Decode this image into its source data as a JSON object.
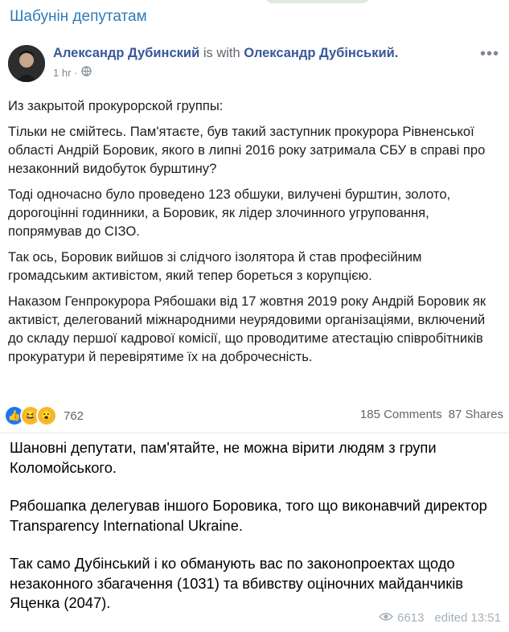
{
  "channel": {
    "title": "Шабунін депутатам"
  },
  "post": {
    "author": "Александр Дубинский",
    "with_text": "is with",
    "tagged": "Олександр Дубінський.",
    "time": "1 hr ·",
    "paragraphs": [
      "Из закрытой прокурорской группы:",
      "Тільки не смійтесь. Пам'ятаєте, був такий заступник прокурора Рівненської області Андрій Боровик, якого в липні 2016 року затримала СБУ в справі про незаконний видобуток бурштину?",
      "Тоді одночасно було проведено 123 обшуки, вилучені бурштин, золото, дорогоцінні годинники, а Боровик, як лідер злочинного угруповання, попрямував до СІЗО.",
      "Так ось, Боровик вийшов зі слідчого ізолятора й став професійним громадським активістом, який тепер бореться з корупцією.",
      "Наказом Генпрокурора Рябошаки від 17 жовтня 2019 року Андрій Боровик як активіст, делегований міжнародними неурядовими організаціями, включений до складу першої кадрової комісії, що проводитиме атестацію співробітників прокуратури й перевірятиме їх на доброчесність."
    ],
    "reactions_count": "762",
    "comments": "185 Comments",
    "shares": "87 Shares"
  },
  "message": {
    "paragraphs": [
      "Шановні депутати, пам'ятайте, не можна вірити людям з групи Коломойського.",
      "Рябошапка делегував іншого Боровика, того що виконавчий директор Transparency International Ukraine.",
      "Так само Дубінський і ко обманують вас по законопроектах щодо незаконного збагачення (1031) та вбивству оціночних майданчиків Яценка (2047)."
    ],
    "views": "6613",
    "edited": "edited 13:51"
  }
}
